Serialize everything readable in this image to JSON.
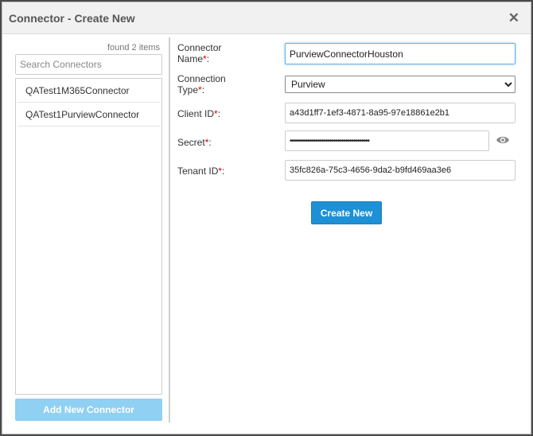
{
  "dialog": {
    "title": "Connector - Create New",
    "close_glyph": "✕"
  },
  "left": {
    "found_text": "found 2 items",
    "search_placeholder": "Search Connectors",
    "items": [
      {
        "label": "QATest1M365Connector"
      },
      {
        "label": "QATest1PurviewConnector"
      }
    ],
    "add_button": "Add New Connector"
  },
  "form": {
    "connector_name_label": "Connector Name",
    "connector_name_value": "PurviewConnectorHouston",
    "connection_type_label": "Connection Type",
    "connection_type_value": "Purview",
    "client_id_label": "Client ID",
    "client_id_value": "a43d1ff7-1ef3-4871-8a95-97e18861e2b1",
    "secret_label": "Secret",
    "secret_value": "••••••••••••••••••••••••••••••••••••••••",
    "tenant_id_label": "Tenant ID",
    "tenant_id_value": "35fc826a-75c3-4656-9da2-b9fd469aa3e6",
    "required_mark": "*",
    "colon": ":",
    "create_button": "Create New"
  },
  "icons": {
    "close": "close-icon",
    "eye": "eye-icon"
  },
  "colors": {
    "primary": "#1e90d5",
    "primary_disabled": "#8fd0f3",
    "required": "#d00000"
  }
}
